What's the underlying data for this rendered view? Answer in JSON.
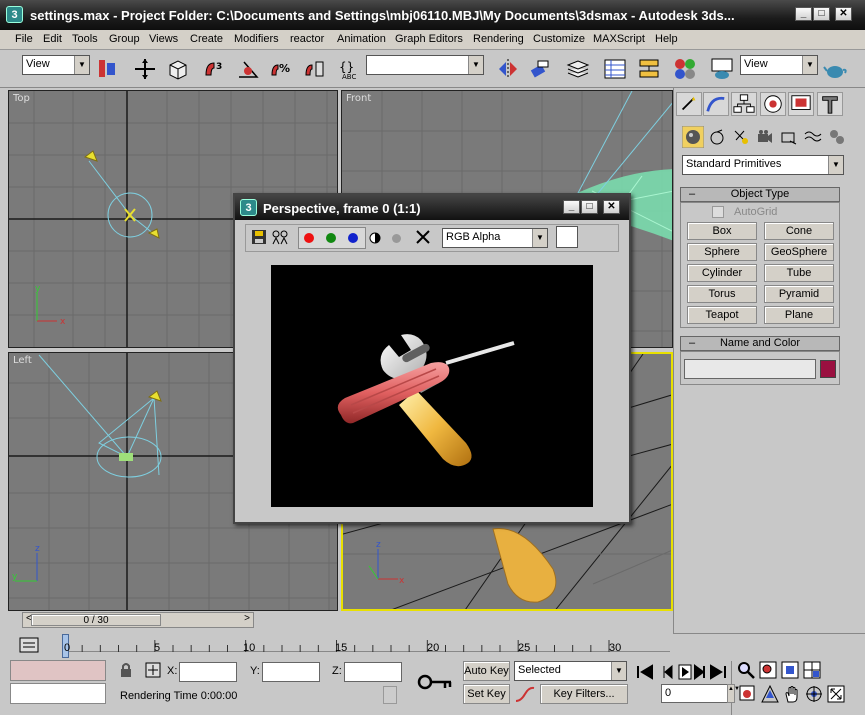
{
  "window": {
    "title": "settings.max - Project Folder: C:\\Documents and Settings\\mbj06110.MBJ\\My Documents\\3dsmax - Autodesk 3ds..."
  },
  "menu": [
    "File",
    "Edit",
    "Tools",
    "Group",
    "Views",
    "Create",
    "Modifiers",
    "reactor",
    "Animation",
    "Graph Editors",
    "Rendering",
    "Customize",
    "MAXScript",
    "Help"
  ],
  "toolbar": {
    "ref_coord": "View",
    "named_selection": "",
    "view_dropdown": "View"
  },
  "viewports": {
    "top": "Top",
    "front": "Front",
    "left": "Left",
    "perspective": "Perspective"
  },
  "command_panel": {
    "category": "Standard Primitives",
    "object_type_header": "Object Type",
    "autogrid": "AutoGrid",
    "buttons": [
      "Box",
      "Cone",
      "Sphere",
      "GeoSphere",
      "Cylinder",
      "Tube",
      "Torus",
      "Pyramid",
      "Teapot",
      "Plane"
    ],
    "name_color_header": "Name and Color",
    "name_value": "",
    "color": "#9a1040"
  },
  "render_window": {
    "title": "Perspective, frame 0 (1:1)",
    "channel": "RGB Alpha"
  },
  "timeline": {
    "frame_counter": "0 / 30",
    "ticks": [
      "0",
      "5",
      "10",
      "15",
      "20",
      "25",
      "30"
    ]
  },
  "status": {
    "x_label": "X:",
    "y_label": "Y:",
    "z_label": "Z:",
    "rendering_time": "Rendering Time  0:00:00",
    "auto_key": "Auto Key",
    "set_key": "Set Key",
    "selected": "Selected",
    "key_filters": "Key Filters...",
    "current_frame": "0"
  }
}
